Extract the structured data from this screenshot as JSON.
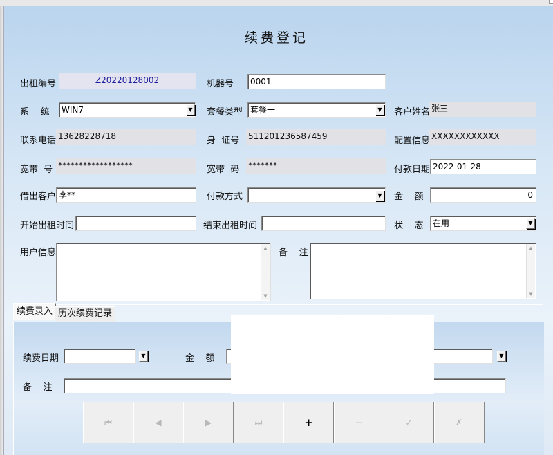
{
  "title": "续费登记",
  "fields": {
    "rental_no": {
      "label": "出租编号",
      "value": "Z20220128002"
    },
    "machine_no": {
      "label": "机器号",
      "value": "0001"
    },
    "system": {
      "label": "系    统",
      "value": "WIN7"
    },
    "package_type": {
      "label": "套餐类型",
      "value": "套餐一"
    },
    "customer_name": {
      "label": "客户姓名",
      "value": "张三"
    },
    "phone": {
      "label": "联系电话",
      "value": "13628228718"
    },
    "id_no": {
      "label": "身  证号",
      "value": "511201236587459"
    },
    "config": {
      "label": "配置信息",
      "value": "XXXXXXXXXXXX"
    },
    "broadband_acct": {
      "label": "宽带  号",
      "value": "******************"
    },
    "broadband_pwd": {
      "label": "宽带  码",
      "value": "*******"
    },
    "pay_date": {
      "label": "付款日期",
      "value": "2022-01-28"
    },
    "borrower": {
      "label": "借出客户",
      "value": "李**"
    },
    "pay_method": {
      "label": "付款方式",
      "value": ""
    },
    "amount": {
      "label": "金    额",
      "value": "0"
    },
    "start_time": {
      "label": "开始出租时间",
      "value": ""
    },
    "end_time": {
      "label": "结束出租时间",
      "value": ""
    },
    "status": {
      "label": "状    态",
      "value": "在用"
    },
    "user_info": {
      "label": "用户信息",
      "value": ""
    },
    "remark": {
      "label": "备    注",
      "value": ""
    }
  },
  "tabs": [
    {
      "label": "续费录入",
      "active": true
    },
    {
      "label": "历次续费记录",
      "active": false
    }
  ],
  "renewal": {
    "date": {
      "label": "续费日期",
      "value": ""
    },
    "amount": {
      "label": "金    额",
      "value": ""
    },
    "remark": {
      "label": "备    注",
      "value": ""
    }
  },
  "nav_buttons": [
    {
      "name": "first-record-icon",
      "glyph": "⏮",
      "enabled": false
    },
    {
      "name": "prev-record-icon",
      "glyph": "◀",
      "enabled": false
    },
    {
      "name": "next-record-icon",
      "glyph": "▶",
      "enabled": false
    },
    {
      "name": "last-record-icon",
      "glyph": "⏭",
      "enabled": false
    },
    {
      "name": "add-record-icon",
      "glyph": "+",
      "enabled": true
    },
    {
      "name": "delete-record-icon",
      "glyph": "−",
      "enabled": false
    },
    {
      "name": "confirm-record-icon",
      "glyph": "✓",
      "enabled": false
    },
    {
      "name": "cancel-record-icon",
      "glyph": "✗",
      "enabled": false
    }
  ]
}
